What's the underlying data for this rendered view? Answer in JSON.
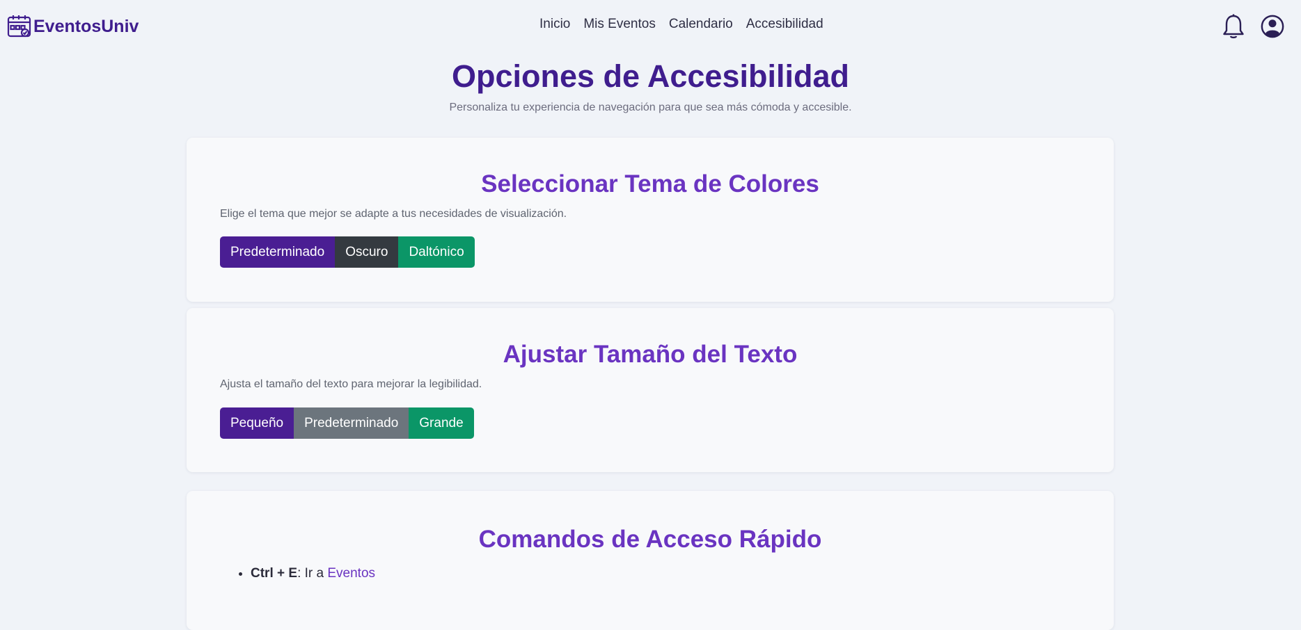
{
  "navbar": {
    "brand": "EventosUniv",
    "links": [
      "Inicio",
      "Mis Eventos",
      "Calendario",
      "Accesibilidad"
    ],
    "icons": [
      "bell-icon",
      "user-circle-icon"
    ]
  },
  "page": {
    "title": "Opciones de Accesibilidad",
    "subtitle": "Personaliza tu experiencia de navegación para que sea más cómoda y accesible."
  },
  "theme_card": {
    "title": "Seleccionar Tema de Colores",
    "description": "Elige el tema que mejor se adapte a tus necesidades de visualización.",
    "buttons": [
      "Predeterminado",
      "Oscuro",
      "Daltónico"
    ]
  },
  "text_size_card": {
    "title": "Ajustar Tamaño del Texto",
    "description": "Ajusta el tamaño del texto para mejorar la legibilidad.",
    "buttons": [
      "Pequeño",
      "Predeterminado",
      "Grande"
    ]
  },
  "shortcuts_card": {
    "title": "Comandos de Acceso Rápido",
    "items": [
      {
        "keys": "Ctrl + E",
        "text": ": Ir a ",
        "link": "Eventos"
      }
    ]
  },
  "colors": {
    "primary": "#3f1d8e",
    "accent": "#6a34c1",
    "button_purple": "#4a1e93",
    "button_dark": "#343a40",
    "button_green": "#0b9667",
    "button_gray": "#6c757d",
    "background": "#f0f3f8"
  }
}
